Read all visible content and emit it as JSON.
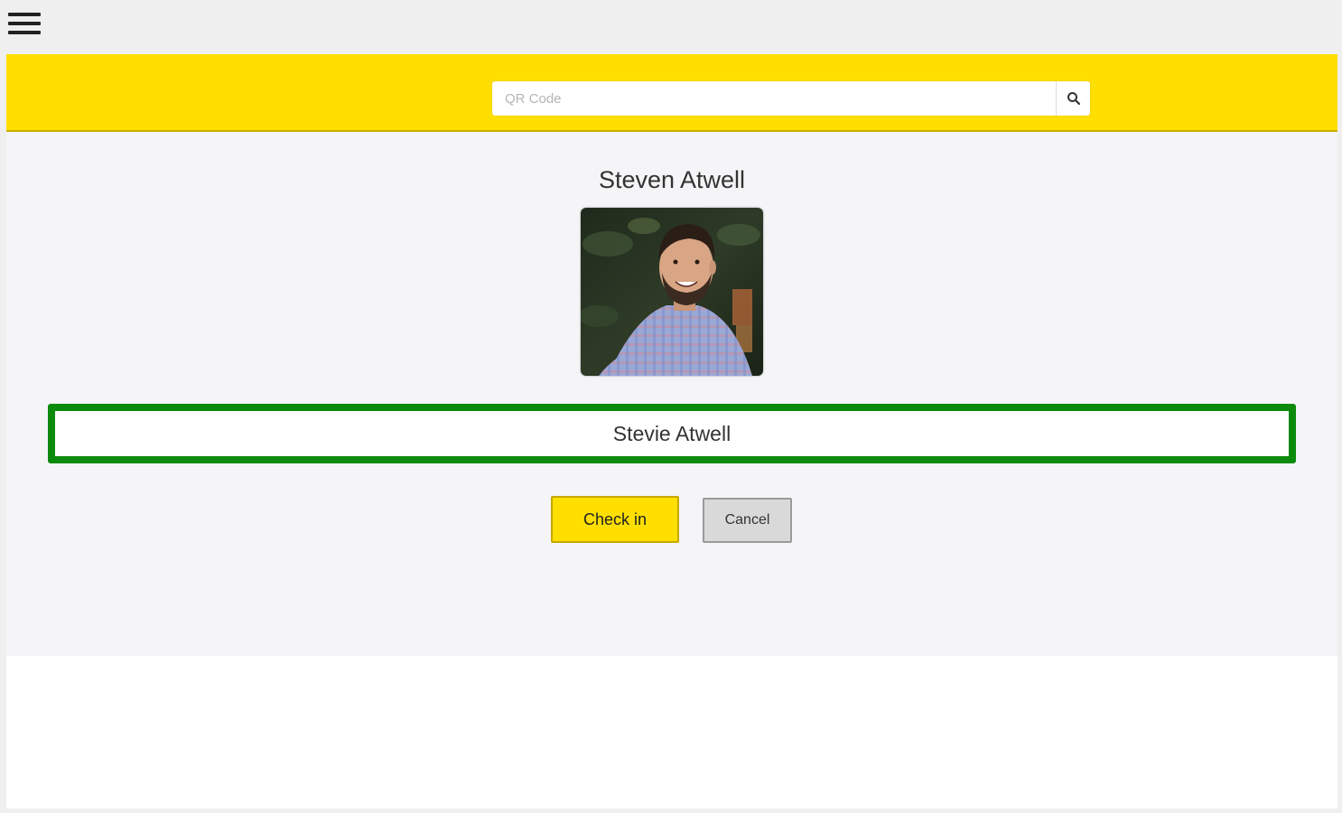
{
  "app": {
    "menu_icon": "hamburger-menu-icon"
  },
  "search": {
    "placeholder": "QR Code",
    "value": "",
    "button_icon": "search-icon"
  },
  "colors": {
    "header_bg": "#ffdf00",
    "nickname_border": "#0c8a0c",
    "checkin_bg": "#ffdf00",
    "cancel_bg": "#d9d9d9"
  },
  "person": {
    "full_name": "Steven Atwell",
    "nickname": "Stevie Atwell",
    "photo": "profile-photo"
  },
  "actions": {
    "checkin_label": "Check in",
    "cancel_label": "Cancel"
  }
}
